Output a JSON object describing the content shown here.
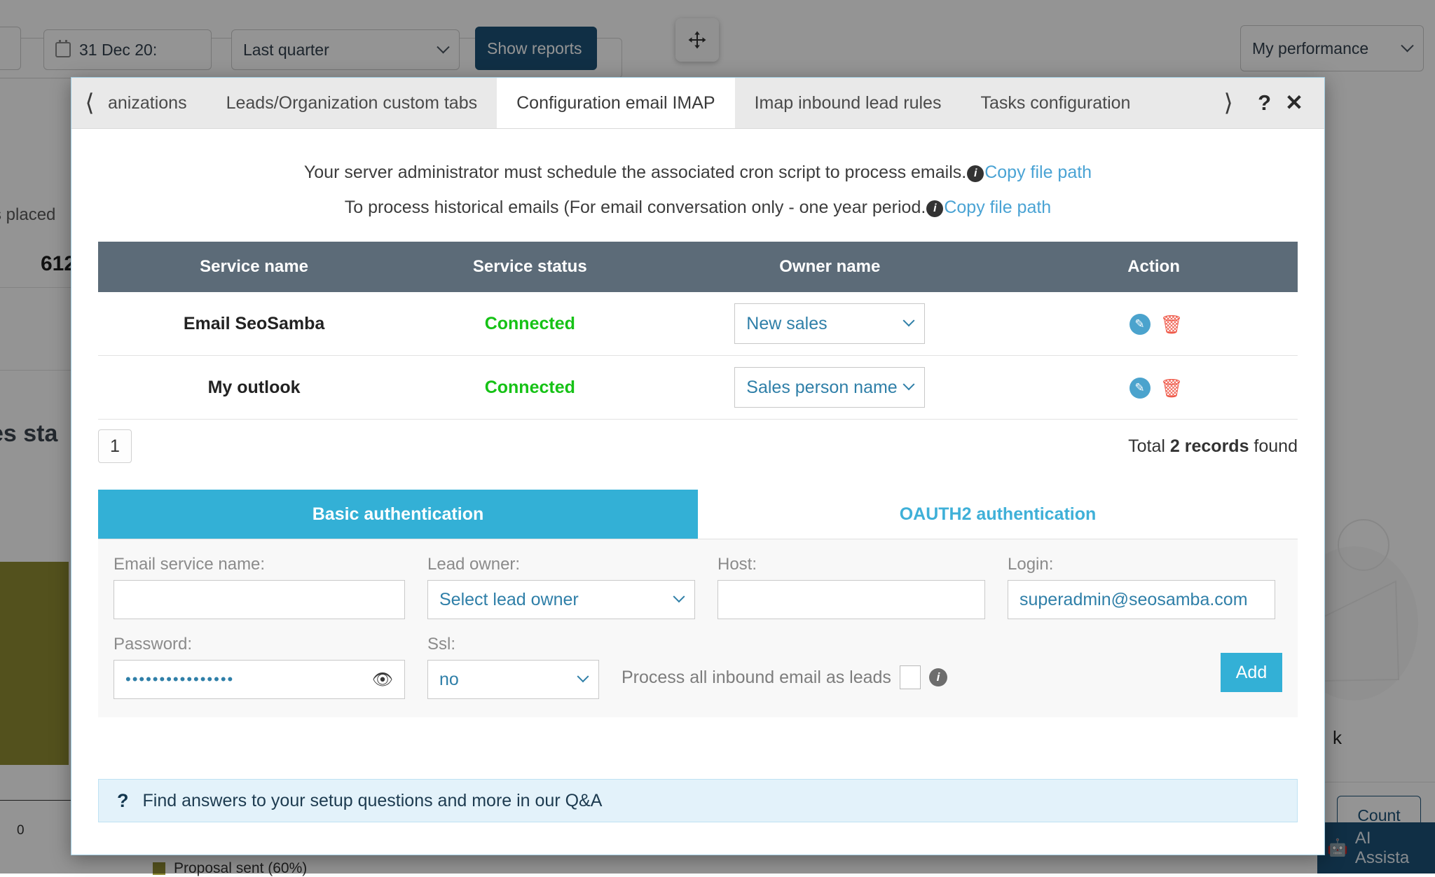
{
  "background": {
    "date_filter": {
      "icon": "calendar-icon",
      "value": "31 Dec 20:"
    },
    "period_select": {
      "value": "Last quarter",
      "icon": "chevron-down-icon"
    },
    "show_reports_button": "Show reports",
    "move_handle_icon": "move-arrows-icon",
    "performance_select": {
      "value": "My performance",
      "icon": "chevron-down-icon"
    },
    "stat_label": "s placed",
    "stat_value": "612",
    "section_heading": "es sta",
    "axis_zero": "0",
    "legend_item": "Proposal sent (60%)",
    "count_button": "Count",
    "ai_assistant": {
      "icon": "robot-icon",
      "label": "AI Assista"
    },
    "k_label": "k"
  },
  "modal": {
    "tabs": [
      {
        "label": "anizations",
        "active": false,
        "clipped": true
      },
      {
        "label": "Leads/Organization custom tabs",
        "active": false
      },
      {
        "label": "Configuration email IMAP",
        "active": true
      },
      {
        "label": "Imap inbound lead rules",
        "active": false
      },
      {
        "label": "Tasks configuration",
        "active": false
      }
    ],
    "prev_arrow_icon": "chevron-left-icon",
    "next_arrow_icon": "chevron-right-icon",
    "help_icon": "question-mark-icon",
    "close_icon": "close-icon",
    "notices": [
      {
        "text": "Your server administrator must schedule the associated cron script to process emails.",
        "info_icon": "info-icon",
        "link": "Copy file path"
      },
      {
        "text": "To process historical emails (For email conversation only - one year period.",
        "info_icon": "info-icon",
        "link": "Copy file path"
      }
    ],
    "table": {
      "headers": [
        "Service name",
        "Service status",
        "Owner name",
        "Action"
      ],
      "rows": [
        {
          "service_name": "Email SeoSamba",
          "service_status": "Connected",
          "owner_name": "New sales",
          "edit_icon": "edit-icon",
          "delete_icon": "trash-icon"
        },
        {
          "service_name": "My outlook",
          "service_status": "Connected",
          "owner_name": "Sales person name",
          "edit_icon": "edit-icon",
          "delete_icon": "trash-icon"
        }
      ]
    },
    "pagination": {
      "current_page": "1",
      "records_prefix": "Total ",
      "records_count": "2 records",
      "records_suffix": " found"
    },
    "auth_tabs": [
      {
        "label": "Basic authentication",
        "active": true
      },
      {
        "label": "OAUTH2 authentication",
        "active": false
      }
    ],
    "form": {
      "email_service_name": {
        "label": "Email service name:",
        "value": ""
      },
      "lead_owner": {
        "label": "Lead owner:",
        "value": "Select lead owner",
        "icon": "chevron-down-icon"
      },
      "host": {
        "label": "Host:",
        "value": ""
      },
      "login": {
        "label": "Login:",
        "value": "superadmin@seosamba.com"
      },
      "password": {
        "label": "Password:",
        "value": "••••••••••••••••",
        "reveal_icon": "eye-icon"
      },
      "ssl": {
        "label": "Ssl:",
        "value": "no",
        "icon": "chevron-down-icon"
      },
      "process_inbound": {
        "label": "Process all inbound email as leads",
        "checked": false,
        "info_icon": "info-icon"
      },
      "add_button": "Add"
    },
    "qa_bar": {
      "icon": "question-mark-icon",
      "text": "Find answers to your setup questions and more in our Q&A"
    },
    "highlight_color": "#fb2f0a"
  }
}
